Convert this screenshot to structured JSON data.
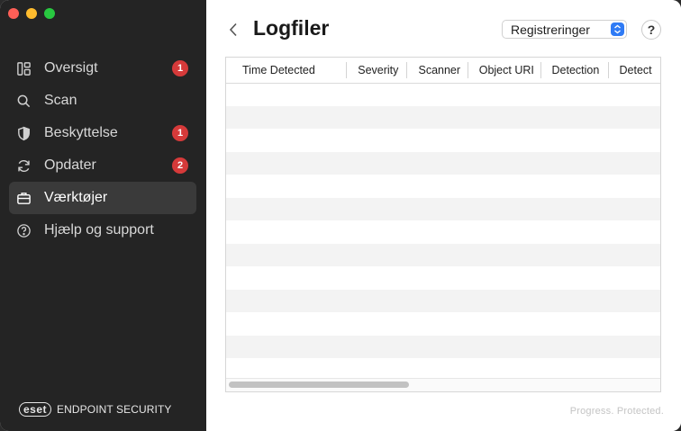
{
  "sidebar": {
    "items": [
      {
        "label": "Oversigt",
        "badge": "1",
        "icon": "overview-icon"
      },
      {
        "label": "Scan",
        "badge": "",
        "icon": "search-icon"
      },
      {
        "label": "Beskyttelse",
        "badge": "1",
        "icon": "shield-icon"
      },
      {
        "label": "Opdater",
        "badge": "2",
        "icon": "refresh-icon"
      },
      {
        "label": "Værktøjer",
        "badge": "",
        "icon": "toolbox-icon",
        "active": true
      },
      {
        "label": "Hjælp og support",
        "badge": "",
        "icon": "help-circle-icon"
      }
    ],
    "brand_logo": "eset",
    "brand_text": "ENDPOINT SECURITY"
  },
  "main": {
    "title": "Logfiler",
    "select_value": "Registreringer",
    "help_label": "?",
    "table": {
      "columns": [
        "Time Detected",
        "Severity",
        "Scanner",
        "Object URI",
        "Detection",
        "Detect"
      ],
      "rows": []
    },
    "tagline": "Progress. Protected."
  },
  "colors": {
    "sidebar_bg": "#242424",
    "badge": "#d63a3a",
    "accent": "#2f7bf5"
  }
}
